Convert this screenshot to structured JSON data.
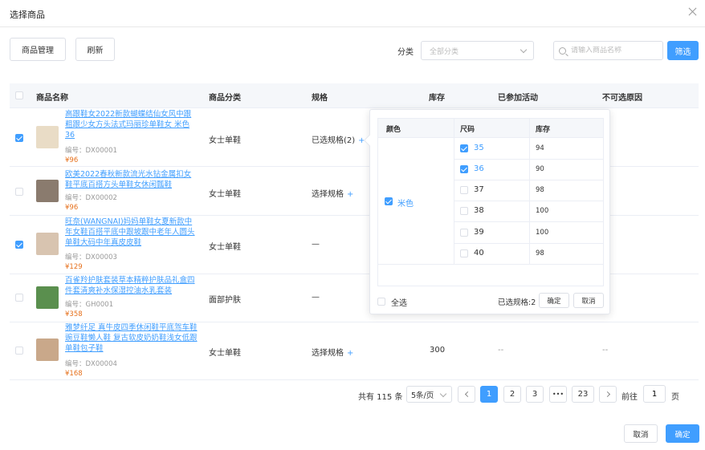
{
  "dialog": {
    "title": "选择商品"
  },
  "toolbar": {
    "manage_label": "商品管理",
    "refresh_label": "刷新",
    "category_label": "分类",
    "category_placeholder": "全部分类",
    "search_placeholder": "请输入商品名称",
    "filter_label": "筛选"
  },
  "table": {
    "headers": [
      "商品名称",
      "商品分类",
      "规格",
      "库存",
      "已参加活动",
      "不可选原因"
    ],
    "rows": [
      {
        "name": "高跟鞋女2022新款蝴蝶结仙女风中跟粗跟少女方头法式玛丽珍单鞋女 米色 36",
        "code": "编号：DX00001",
        "price": "¥96",
        "category": "女士单鞋",
        "spec": "已选规格(2)",
        "spec_plus": "+",
        "stock": "",
        "activity": "",
        "reason": "",
        "checked": true,
        "thumb_color": "#e9dcc6"
      },
      {
        "name": "欧美2022春秋新款流光水钻金属扣女鞋平底百搭方头单鞋女休闲瓢鞋",
        "code": "编号：DX00002",
        "price": "¥96",
        "category": "女士单鞋",
        "spec": "选择规格",
        "spec_plus": "+",
        "stock": "",
        "activity": "",
        "reason": "",
        "checked": false,
        "thumb_color": "#8a7b6e"
      },
      {
        "name": "旺奈(WANGNAI)妈妈单鞋女夏新款中年女鞋百搭平底中跟坡跟中老年人圆头单鞋大码中年真皮皮鞋",
        "code": "编号：DX00003",
        "price": "¥129",
        "category": "女士单鞋",
        "spec": "—",
        "spec_plus": "",
        "stock": "",
        "activity": "",
        "reason": "",
        "checked": true,
        "thumb_color": "#d8c4b0"
      },
      {
        "name": "百雀羚护肤套装草本精粹护肤品礼盒四件套清爽补水保湿控油水乳套装",
        "code": "编号：GH0001",
        "price": "¥358",
        "category": "面部护肤",
        "spec": "—",
        "spec_plus": "",
        "stock": "",
        "activity": "",
        "reason": "",
        "checked": false,
        "thumb_color": "#5a8f4e"
      },
      {
        "name": "雅梦纤足 真牛皮四季休闲鞋平底驾车鞋豌豆鞋懒人鞋 复古软皮奶奶鞋浅女低跟单鞋包子鞋",
        "code": "编号：DX00004",
        "price": "¥168",
        "category": "女士单鞋",
        "spec": "选择规格",
        "spec_plus": "+",
        "stock": "300",
        "activity": "--",
        "reason": "--",
        "checked": false,
        "thumb_color": "#c9a88a"
      }
    ]
  },
  "spec_popover": {
    "headers": {
      "color": "颜色",
      "size": "尺码",
      "stock": "库存"
    },
    "color": "米色",
    "sizes": [
      {
        "size": "35",
        "stock": "94",
        "checked": true
      },
      {
        "size": "36",
        "stock": "90",
        "checked": true
      },
      {
        "size": "37",
        "stock": "98",
        "checked": false
      },
      {
        "size": "38",
        "stock": "100",
        "checked": false
      },
      {
        "size": "39",
        "stock": "100",
        "checked": false
      },
      {
        "size": "40",
        "stock": "98",
        "checked": false
      }
    ],
    "select_all_label": "全选",
    "selected_text": "已选规格:2",
    "confirm_label": "确定",
    "cancel_label": "取消"
  },
  "pagination": {
    "total_text": "共有 115 条",
    "page_size": "5条/页",
    "pages": [
      "1",
      "2",
      "3",
      "•••",
      "23"
    ],
    "current_page": "1",
    "goto_label": "前往",
    "goto_value": "1",
    "page_unit": "页"
  },
  "footer": {
    "cancel_label": "取消",
    "confirm_label": "确定"
  },
  "colors": {
    "primary": "#409eff",
    "price": "#e6711d"
  }
}
